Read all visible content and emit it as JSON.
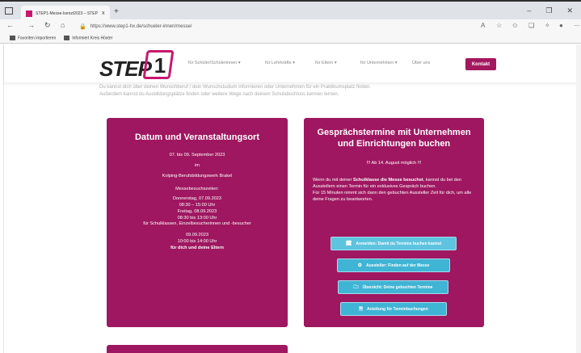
{
  "browser": {
    "tab_title": "STEP1-Messe-Ixenzt2023 – STEP 1",
    "tab_close": "x",
    "new_tab": "+",
    "url": "https://www.step1-hx.de/schueler-innen/messe/",
    "window_controls": [
      "–",
      "❐",
      "✕"
    ],
    "bookmarks": [
      "Favoriten importieren",
      "Informiert Kreis Höxter"
    ]
  },
  "header": {
    "logo_text": "STEP",
    "logo_number": "1",
    "menu": [
      "für Schüler/Schülerinnen ▾",
      "für Lehrkräfte ▾",
      "für Eltern ▾",
      "für Unternehmen ▾",
      "Über uns"
    ],
    "contact_label": "Kontakt"
  },
  "intro": {
    "line1": "Du kannst dich über deinen Wunschberuf / dein Wunschstudium informieren oder Unternehmen für ein Praktikumsplatz finden.",
    "line2": "Außerdem kannst du Ausbildungsplätze finden oder weitere Wege nach deinem Schulabschluss kennen lernen."
  },
  "card_event": {
    "title": "Datum und Veranstaltungsort",
    "dates": "07. bis 09. September 2023",
    "in": "im",
    "venue": "Kolping-Berufsbildungswerk Brakel",
    "hours_title": "Messebesuchszeiten:",
    "hours": [
      "Donnerstag, 07.09.2023",
      "08:30 – 15:00 Uhr",
      "Freitag, 08.09.2023",
      "08:30 bis 13:00 Uhr",
      "für Schulklassen, Einzelbesucherinnen und -besucher"
    ],
    "saturday": [
      "09.09.2023",
      "10:00 bis 14:00 Uhr"
    ],
    "saturday_note": "für dich und deine Eltern"
  },
  "card_booking": {
    "title": "Gesprächstermine mit Unternehmen und Einrichtungen buchen",
    "highlight": "!!! Ab 14. August möglich !!!",
    "text_pre": "Wenn du mit deiner ",
    "text_bold": "Schulklasse die Messe besuchst",
    "text_post": ", kannst du bei den Ausstellern einen Termin für ein exklusives Gespräch buchen.",
    "text2": "Für 15 Minuten nimmt sich dann den gebuchten Aussteller Zeit für dich, um alle deine Fragen zu beantworten.",
    "buttons": [
      {
        "icon": "🗓",
        "label": "Anmelden: Damit du Termine buchen kannst"
      },
      {
        "icon": "⚙",
        "label": "Aussteller: Finden auf der Messe"
      },
      {
        "icon": "🗀",
        "label": "Übersicht: Deine gebuchten Termine"
      },
      {
        "icon": "🗎",
        "label": "Anleitung für Terminbuchungen"
      }
    ]
  },
  "colors": {
    "brand": "#9e1760",
    "button": "#40b4d4"
  }
}
